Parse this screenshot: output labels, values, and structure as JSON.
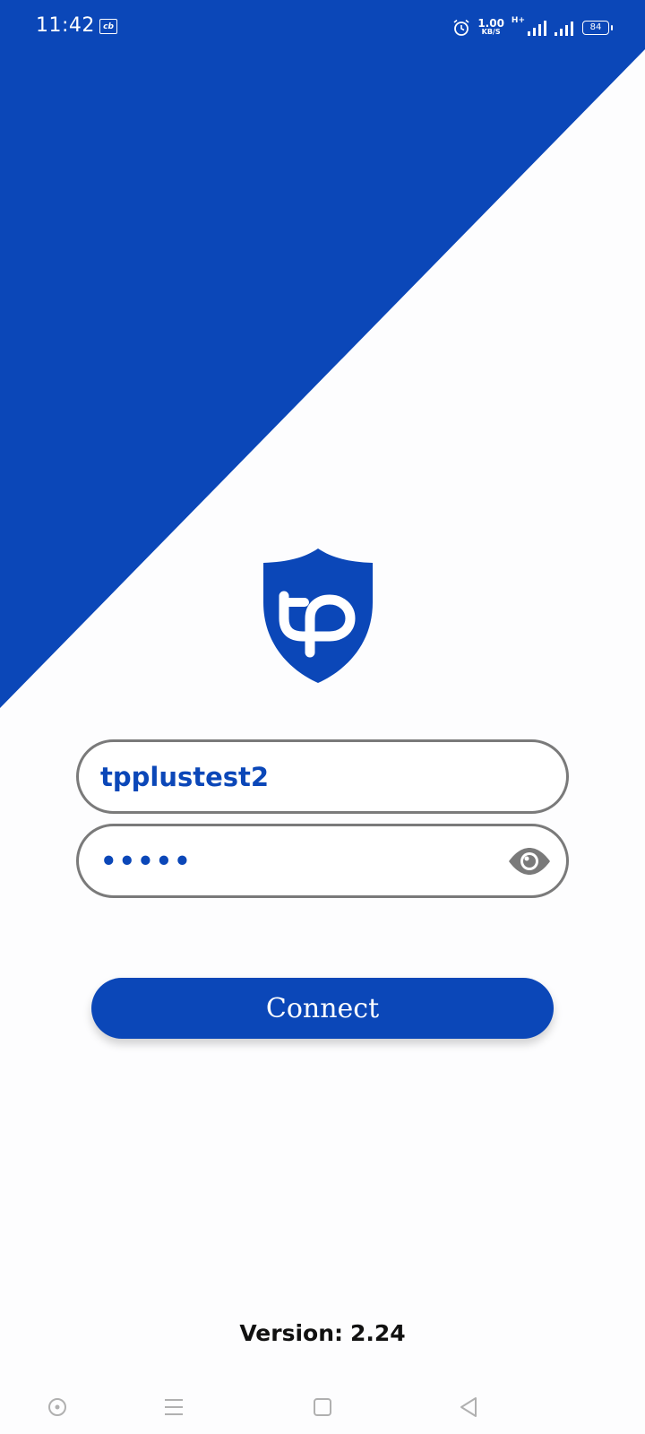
{
  "status_bar": {
    "time": "11:42",
    "notification_icon": "cb",
    "speed_value": "1.00",
    "speed_unit": "KB/S",
    "network_type": "H+",
    "battery": "84",
    "icons": [
      "alarm-icon",
      "signal-icon",
      "signal-icon-2",
      "battery-icon"
    ]
  },
  "login": {
    "username": "tpplustest2",
    "password": "•••••",
    "connect_label": "Connect"
  },
  "footer": {
    "version_label": "Version:",
    "version_value": "2.24"
  },
  "nav": {
    "icons": [
      "assistant-icon",
      "menu-icon",
      "home-icon",
      "back-icon"
    ]
  },
  "colors": {
    "brand": "#0b47b8",
    "background": "#fdfdfe",
    "field_border": "#7a7a7a"
  },
  "logo": {
    "icon": "shield-tp-logo"
  }
}
